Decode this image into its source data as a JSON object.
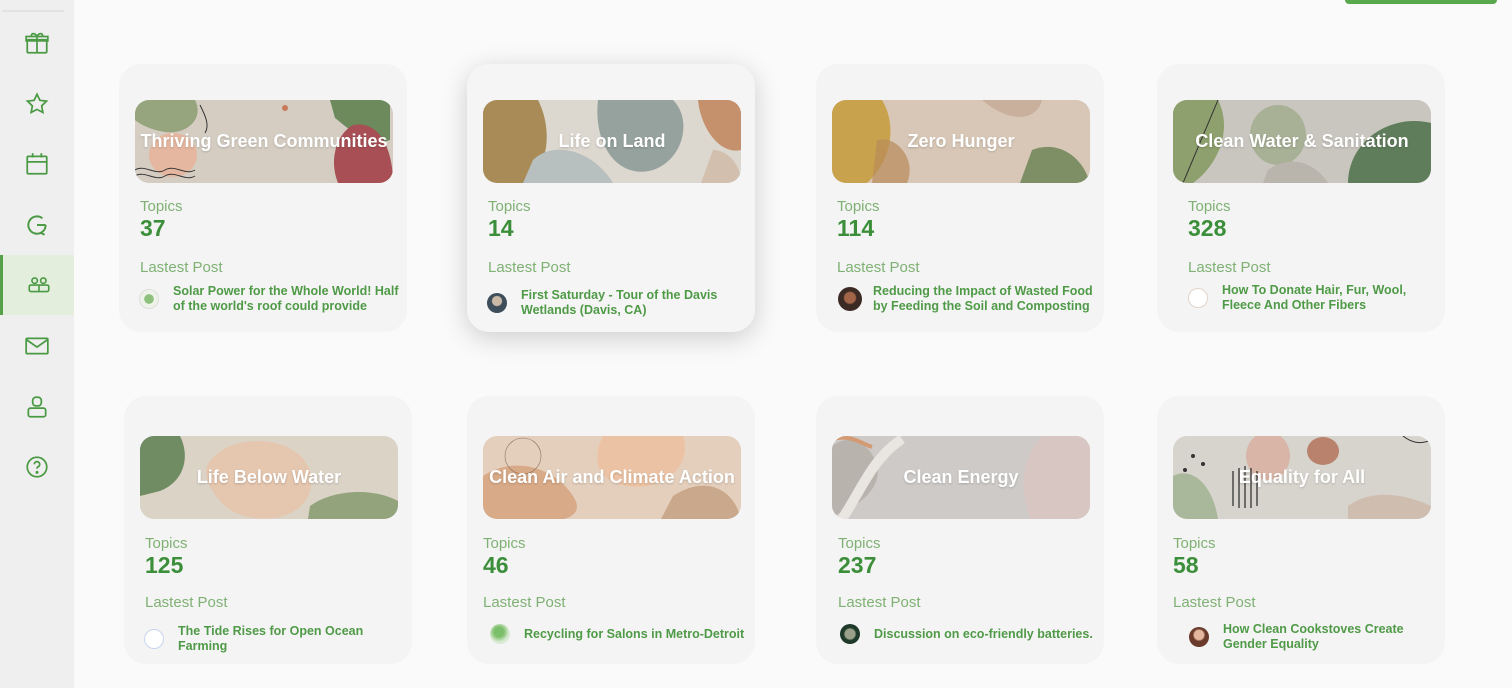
{
  "sidebar": {
    "items": [
      {
        "icon": "gift-icon"
      },
      {
        "icon": "star-icon"
      },
      {
        "icon": "calendar-icon"
      },
      {
        "icon": "refresh-icon"
      },
      {
        "icon": "community-icon",
        "active": true
      },
      {
        "icon": "mail-icon"
      },
      {
        "icon": "user-icon"
      },
      {
        "icon": "help-icon"
      }
    ]
  },
  "labels": {
    "topics": "Topics",
    "latest_post": "Lastest Post"
  },
  "communities": [
    {
      "title": "Thriving Green Communities",
      "topics": "37",
      "latest_post": "Solar Power  for the Whole World! Half of the world's roof could provide"
    },
    {
      "title": "Life on Land",
      "topics": "14",
      "latest_post": "First Saturday - Tour of the Davis Wetlands (Davis, CA)"
    },
    {
      "title": "Zero Hunger",
      "topics": "114",
      "latest_post": "Reducing the Impact of Wasted Food by Feeding the Soil and Composting"
    },
    {
      "title": "Clean Water & Sanitation",
      "topics": "328",
      "latest_post": "How To Donate Hair, Fur, Wool, Fleece And Other Fibers"
    },
    {
      "title": "Life Below Water",
      "topics": "125",
      "latest_post": "The Tide Rises for Open Ocean Farming"
    },
    {
      "title": "Clean Air and Climate Action",
      "topics": "46",
      "latest_post": "Recycling for Salons in Metro-Detroit"
    },
    {
      "title": "Clean Energy",
      "topics": "237",
      "latest_post": "Discussion on eco-friendly batteries."
    },
    {
      "title": "Equality for All",
      "topics": "58",
      "latest_post": "How Clean Cookstoves Create Gender Equality"
    }
  ],
  "colors": {
    "accent": "#57a04a",
    "text_green": "#4f9a47",
    "label_green": "#7fb174"
  }
}
